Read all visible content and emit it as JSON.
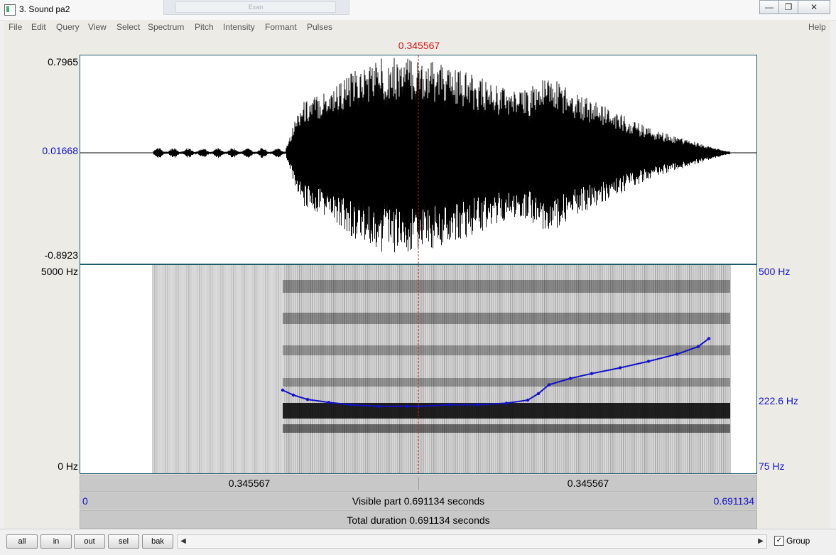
{
  "window": {
    "title": "3. Sound pa2",
    "background_window_label": "Exan"
  },
  "menu": [
    "File",
    "Edit",
    "Query",
    "View",
    "Select",
    "Spectrum",
    "Pitch",
    "Intensity",
    "Formant",
    "Pulses"
  ],
  "help_label": "Help",
  "cursor": {
    "time_label": "0.345567"
  },
  "waveform": {
    "max_label": "0.7965",
    "zero_label": "0.01668",
    "min_label": "-0.8923"
  },
  "spectrogram": {
    "freq_top_label": "5000 Hz",
    "freq_bottom_label": "0 Hz",
    "pitch_top_label": "500 Hz",
    "pitch_mid_label": "222.6 Hz",
    "pitch_bottom_label": "75 Hz"
  },
  "time_bar": {
    "left_label": "0.345567",
    "right_label": "0.345567"
  },
  "visible_bar": {
    "start": "0",
    "text": "Visible part 0.691134 seconds",
    "end": "0.691134"
  },
  "total_bar": {
    "text": "Total duration 0.691134 seconds"
  },
  "buttons": {
    "all": "all",
    "in": "in",
    "out": "out",
    "sel": "sel",
    "bak": "bak"
  },
  "group": {
    "label": "Group",
    "checked": true
  },
  "colors": {
    "cursor": "#d41414",
    "pitch": "#1212c8",
    "axis_blue": "#1212c8",
    "waveform": "#000000"
  }
}
